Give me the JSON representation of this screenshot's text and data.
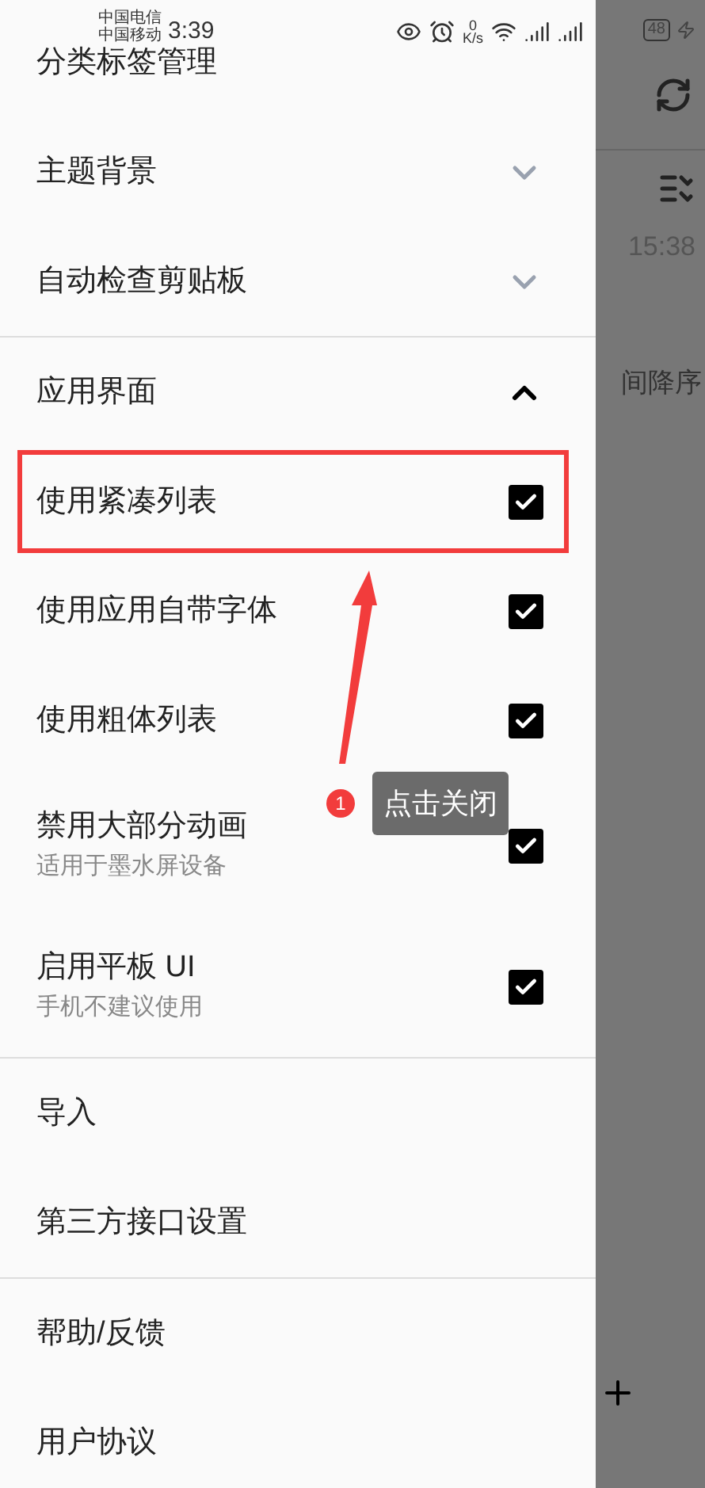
{
  "status_bar": {
    "carrier_1": "中国电信",
    "carrier_2": "中国移动",
    "time": "3:39",
    "speed_value": "0",
    "speed_unit": "K/s",
    "battery": "48"
  },
  "drawer": {
    "sections": [
      {
        "items": [
          {
            "kind": "link",
            "label": "分类标签管理"
          },
          {
            "kind": "expander",
            "label": "主题背景",
            "expanded": false
          },
          {
            "kind": "expander",
            "label": "自动检查剪贴板",
            "expanded": false
          }
        ]
      },
      {
        "items": [
          {
            "kind": "expander",
            "label": "应用界面",
            "expanded": true
          },
          {
            "kind": "checkbox",
            "label": "使用紧凑列表",
            "checked": true,
            "highlighted": true
          },
          {
            "kind": "checkbox",
            "label": "使用应用自带字体",
            "checked": true
          },
          {
            "kind": "checkbox",
            "label": "使用粗体列表",
            "checked": true
          },
          {
            "kind": "checkbox",
            "label": "禁用大部分动画",
            "subtitle": "适用于墨水屏设备",
            "checked": true
          },
          {
            "kind": "checkbox",
            "label": "启用平板 UI",
            "subtitle": "手机不建议使用",
            "checked": true
          }
        ]
      },
      {
        "items": [
          {
            "kind": "link",
            "label": "导入"
          },
          {
            "kind": "link",
            "label": "第三方接口设置"
          }
        ]
      },
      {
        "items": [
          {
            "kind": "link",
            "label": "帮助/反馈"
          },
          {
            "kind": "link",
            "label": "用户协议"
          }
        ]
      }
    ]
  },
  "background": {
    "time": "15:38",
    "sort_label": "间降序"
  },
  "annotation": {
    "badge": "1",
    "label": "点击关闭"
  }
}
